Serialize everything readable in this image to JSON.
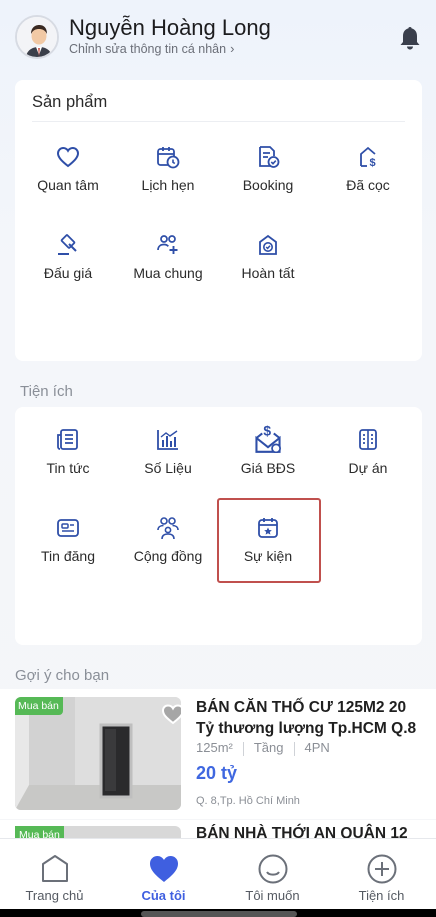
{
  "profile": {
    "name": "Nguyễn Hoàng Long",
    "edit_label": "Chỉnh sửa thông tin cá nhân",
    "edit_chevron": "›"
  },
  "products": {
    "title": "Sản phẩm",
    "items": [
      {
        "label": "Quan tâm",
        "icon": "heart-icon"
      },
      {
        "label": "Lịch hẹn",
        "icon": "calendar-clock-icon"
      },
      {
        "label": "Booking",
        "icon": "document-check-icon"
      },
      {
        "label": "Đã cọc",
        "icon": "house-dollar-icon"
      },
      {
        "label": "Đấu giá",
        "icon": "gavel-icon"
      },
      {
        "label": "Mua chung",
        "icon": "people-add-icon"
      },
      {
        "label": "Hoàn tất",
        "icon": "house-check-icon"
      }
    ]
  },
  "utilities": {
    "title": "Tiện ích",
    "items": [
      {
        "label": "Tin tức",
        "icon": "newspaper-icon"
      },
      {
        "label": "Số Liệu",
        "icon": "bar-chart-icon"
      },
      {
        "label": "Giá BĐS",
        "icon": "price-tag-icon"
      },
      {
        "label": "Dự án",
        "icon": "building-icon"
      },
      {
        "label": "Tin đăng",
        "icon": "id-card-icon"
      },
      {
        "label": "Cộng đồng",
        "icon": "community-icon"
      },
      {
        "label": "Sự kiện",
        "icon": "event-calendar-icon"
      }
    ]
  },
  "recommend": {
    "title": "Gợi ý cho bạn",
    "listings": [
      {
        "badge": "Mua bán",
        "title": "BÁN CĂN THỐ CƯ 125M2 20 Tỷ thương lượng Tp.HCM Q.8",
        "area": "125m²",
        "floor": "Tầng",
        "rooms": "4PN",
        "price": "20 tỷ",
        "location": "Q. 8,Tp. Hồ Chí Minh"
      },
      {
        "badge": "Mua bán",
        "title": "BÁN NHÀ THỚI AN QUẬN 12"
      }
    ]
  },
  "tabs": [
    {
      "label": "Trang chủ",
      "icon": "home-icon",
      "active": false
    },
    {
      "label": "Của tôi",
      "icon": "heart-filled-icon",
      "active": true
    },
    {
      "label": "Tôi muốn",
      "icon": "smile-icon",
      "active": false
    },
    {
      "label": "Tiện ích",
      "icon": "plus-circle-icon",
      "active": false
    }
  ],
  "colors": {
    "accent": "#3f5fe0",
    "icon_blue": "#2f4fa8",
    "price": "#3f67e0",
    "badge": "#56b956",
    "highlight": "#c0504d"
  }
}
